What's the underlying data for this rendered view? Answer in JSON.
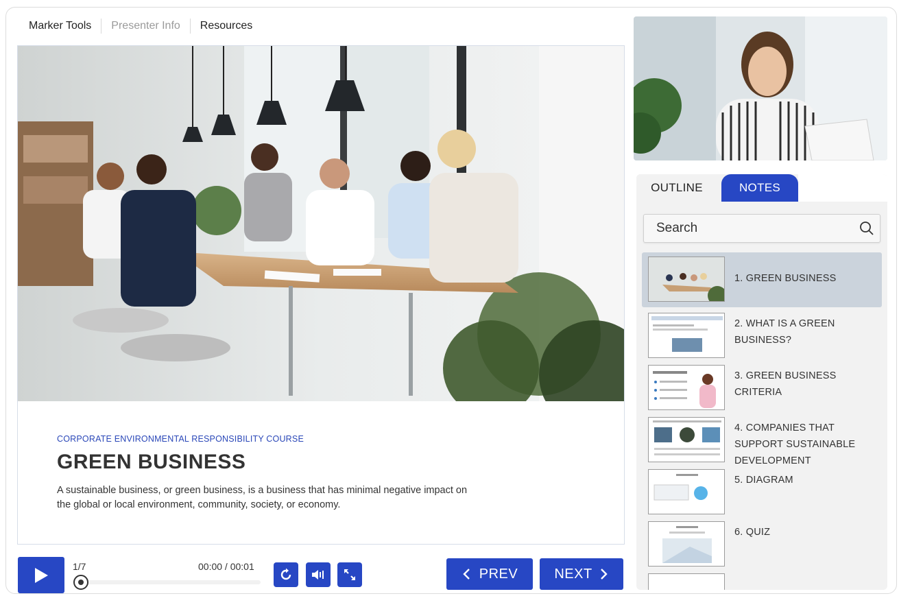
{
  "top_tabs": [
    "Marker Tools",
    "Presenter Info",
    "Resources"
  ],
  "slide": {
    "kicker": "CORPORATE ENVIRONMENTAL RESPONSIBILITY COURSE",
    "headline": "GREEN BUSINESS",
    "body": "A sustainable business, or green business, is a business that has minimal negative impact on the global or local environment, community, society, or economy."
  },
  "player": {
    "counter": "1/7",
    "time": "00:00 / 00:01",
    "progress_fraction": 0.0,
    "prev_label": "PREV",
    "next_label": "NEXT"
  },
  "panel": {
    "tab_outline": "OUTLINE",
    "tab_notes": "NOTES",
    "active_tab": "NOTES",
    "search_placeholder": "Search",
    "items": [
      {
        "label": "1. GREEN BUSINESS"
      },
      {
        "label": "2. WHAT IS A GREEN BUSINESS?"
      },
      {
        "label": "3. GREEN BUSINESS CRITERIA"
      },
      {
        "label": "4. COMPANIES THAT SUPPORT SUSTAINABLE DEVELOPMENT"
      },
      {
        "label": "5. DIAGRAM"
      },
      {
        "label": "6. QUIZ"
      }
    ],
    "active_item": 0
  },
  "colors": {
    "accent": "#2747c4",
    "kicker": "#2a47b8",
    "active_item_bg": "#cbd3dc",
    "panel_bg": "#f2f2f2"
  },
  "icons": {
    "play": "play-icon",
    "replay": "replay-icon",
    "volume": "volume-icon",
    "fullscreen": "fullscreen-icon",
    "search": "search-icon",
    "prev": "chevron-left-icon",
    "next": "chevron-right-icon"
  }
}
